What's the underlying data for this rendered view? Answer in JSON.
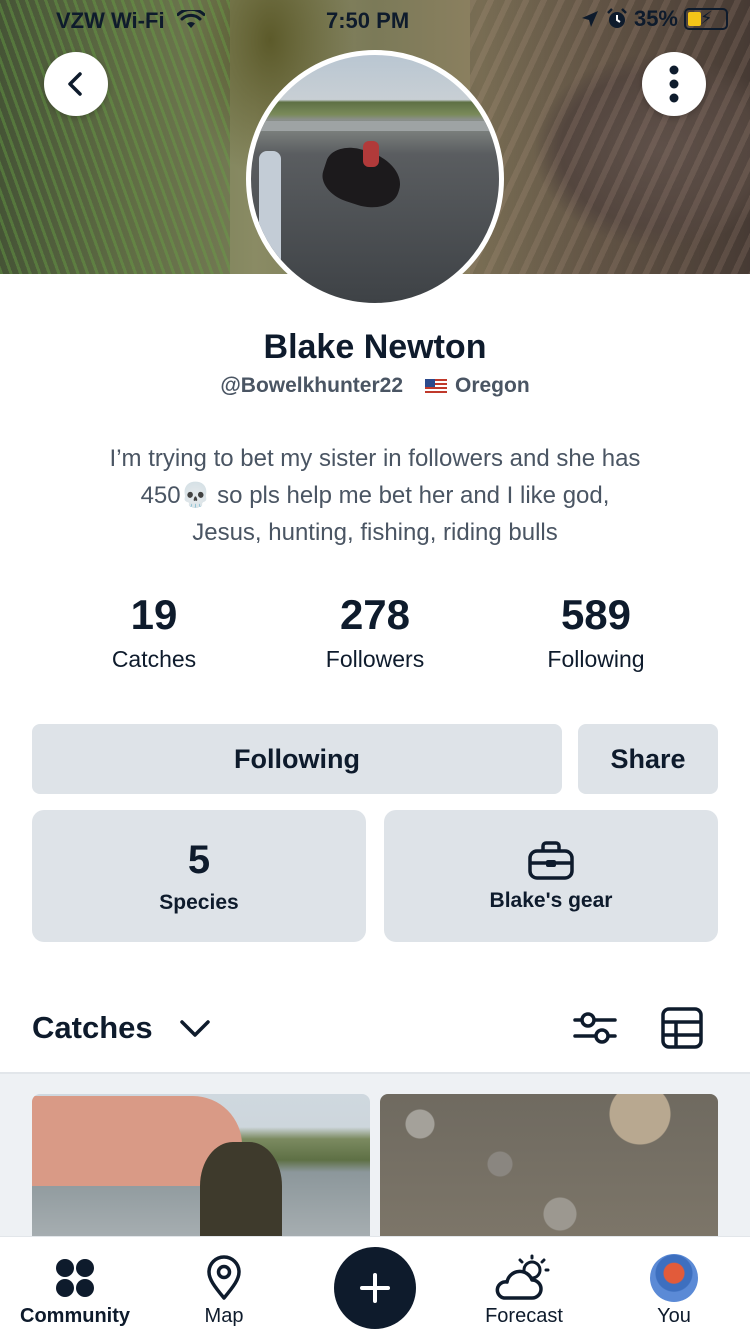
{
  "status_bar": {
    "carrier": "VZW Wi-Fi",
    "time": "7:50 PM",
    "battery": "35%",
    "battery_level": 0.35
  },
  "profile": {
    "name": "Blake Newton",
    "handle": "@Bowelkhunter22",
    "location": "Oregon",
    "bio_line1": "I’m trying to bet my sister in followers and she has",
    "bio_line2_a": "450",
    "bio_emoji": "💀",
    "bio_line2_b": "so pls help me bet her and I like god,",
    "bio_line3": "Jesus, hunting, fishing, riding bulls"
  },
  "stats": [
    {
      "value": "19",
      "label": "Catches"
    },
    {
      "value": "278",
      "label": "Followers"
    },
    {
      "value": "589",
      "label": "Following"
    }
  ],
  "actions": {
    "following_label": "Following",
    "share_label": "Share"
  },
  "cards": {
    "species_count": "5",
    "species_label": "Species",
    "gear_label": "Blake's gear"
  },
  "catches": {
    "title": "Catches"
  },
  "tabbar": {
    "community": "Community",
    "map": "Map",
    "forecast": "Forecast",
    "you": "You"
  },
  "icons": {
    "back": "chevron-left-icon",
    "more": "vertical-dots-icon",
    "wifi": "wifi-icon",
    "location": "location-arrow-icon",
    "alarm": "alarm-icon",
    "gear": "tackle-box-icon",
    "filter": "sliders-icon",
    "grid": "grid-view-icon",
    "community": "community-dots-icon",
    "map": "map-pin-icon",
    "add": "plus-icon",
    "forecast": "cloud-sun-icon"
  },
  "colors": {
    "primary": "#0e1b2c",
    "card_bg": "#dee3e8",
    "muted_text": "#4a5563",
    "battery": "#f5c518"
  }
}
